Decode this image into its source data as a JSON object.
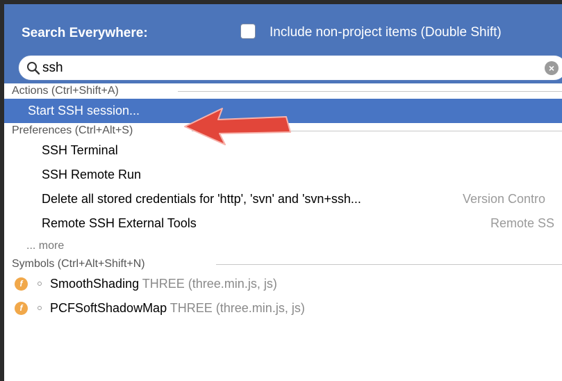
{
  "popup": {
    "title": "Search Everywhere:",
    "include_non_project": {
      "label": "Include non-project items (Double Shift)",
      "checked": false
    }
  },
  "search": {
    "value": "ssh",
    "icon": "search-icon",
    "clear_icon": "clear-icon"
  },
  "sections": {
    "actions": {
      "header": "Actions (Ctrl+Shift+A)",
      "items": [
        {
          "label": "Start SSH session...",
          "selected": true
        }
      ]
    },
    "preferences": {
      "header": "Preferences (Ctrl+Alt+S)",
      "items": [
        {
          "label": "SSH Terminal",
          "hint": ""
        },
        {
          "label": "SSH Remote Run",
          "hint": ""
        },
        {
          "label": "Delete all stored credentials for 'http', 'svn' and 'svn+ssh...",
          "hint": "Version Contro"
        },
        {
          "label": "Remote SSH External Tools",
          "hint": "Remote SS"
        }
      ],
      "more": "... more"
    },
    "symbols": {
      "header": "Symbols (Ctrl+Alt+Shift+N)",
      "items": [
        {
          "name": "SmoothShading",
          "context": "THREE (three.min.js, js)",
          "icon": "f"
        },
        {
          "name": "PCFSoftShadowMap",
          "context": "THREE (three.min.js, js)",
          "icon": "f"
        }
      ]
    }
  },
  "colors": {
    "header_bg": "#4c75ba",
    "selection_bg": "#4875c4",
    "annotation_arrow": "#e2463a",
    "function_icon": "#f1a84a"
  }
}
